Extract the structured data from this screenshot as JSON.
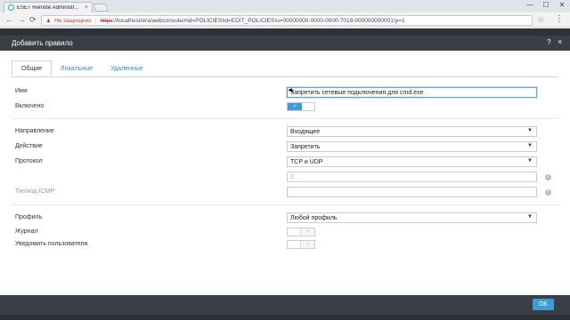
{
  "browser": {
    "tab_title": "ESET Remote Administr...",
    "tab_close": "×",
    "minimize": "—",
    "maximize": "☐",
    "close": "✕",
    "security_label": "Не защищено",
    "url_scheme": "https",
    "url_rest": "://localhost/era/webconsole/#id=POLICIES!id=EDIT_POLICIES!u=00000000-0000-0000-7019-000000000001!p=1"
  },
  "dialog": {
    "title": "Добавить правило",
    "help": "?",
    "close": "×",
    "tabs": [
      {
        "label": "Общие"
      },
      {
        "label": "Локальные"
      },
      {
        "label": "Удаленные"
      }
    ],
    "fields": {
      "name_label": "Имя",
      "name_value": "Запретить сетевые подключения для cmd.exe",
      "enabled_label": "Включено",
      "enabled_check": "✓",
      "direction_label": "Направление",
      "direction_value": "Входящее",
      "action_label": "Действие",
      "action_value": "Запретить",
      "protocol_label": "Протокол",
      "protocol_value": "TCP и UDP",
      "protocol_number": "0",
      "icmp_label": "Тип/код ICMP",
      "icmp_value": "",
      "profile_label": "Профиль",
      "profile_value": "Любой профиль",
      "log_label": "Журнал",
      "notify_label": "Уведомить пользователя"
    },
    "ok_label": "OK"
  },
  "icons": [
    "favicon-icon",
    "back-icon",
    "forward-icon",
    "reload-icon",
    "warning-icon",
    "star-icon",
    "menu-icon",
    "info-icon",
    "chevron-down-icon"
  ]
}
